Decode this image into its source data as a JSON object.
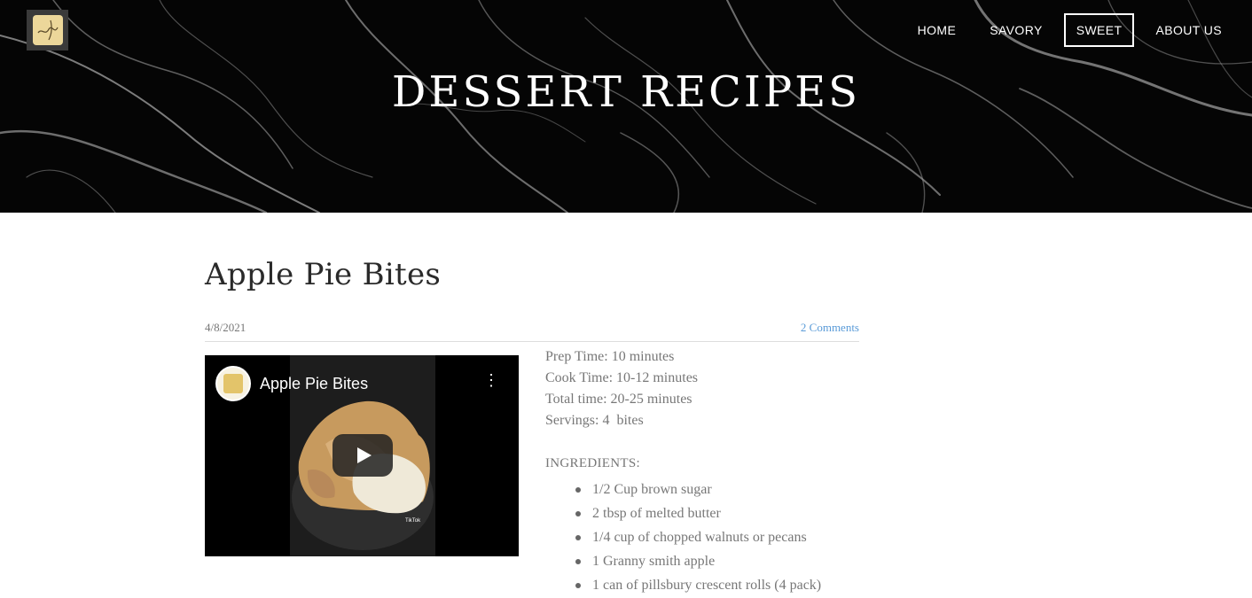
{
  "site": {
    "logo": "logo-icon",
    "nav": {
      "home": "HOME",
      "savory": "SAVORY",
      "sweet": "SWEET",
      "about": "ABOUT US"
    },
    "hero_title": "DESSERT RECIPES"
  },
  "post": {
    "title": "Apple Pie Bites",
    "date": "4/8/2021",
    "comments": "2 Comments",
    "video": {
      "title": "Apple Pie Bites",
      "menu": "⋮",
      "play": "play-icon",
      "watermark": "TikTok"
    },
    "details": {
      "prep": "Prep Time: 10 minutes",
      "cook": "Cook Time: 10-12 minutes",
      "total": "Total time: 20-25 minutes",
      "servings": "Servings: 4  bites"
    },
    "ingredients_heading": "INGREDIENTS:",
    "ingredients": [
      "1/2 Cup brown sugar",
      "2 tbsp of melted butter",
      "1/4 cup of chopped walnuts or pecans",
      "1 Granny smith apple",
      "1 can of pillsbury crescent rolls (4 pack)"
    ]
  },
  "colors": {
    "hero_bg": "#050505",
    "link": "#5a9bd8",
    "text": "#777777",
    "title": "#2a2a2a"
  }
}
